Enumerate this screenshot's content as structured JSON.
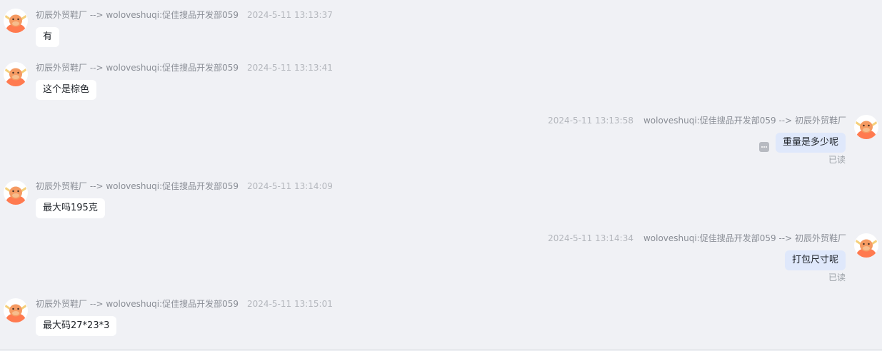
{
  "messages": [
    {
      "direction": "in",
      "sender": "初辰外贸鞋厂 --> woloveshuqi:促佳搜品开发部059",
      "time": "2024-5-11 13:13:37",
      "text": "有"
    },
    {
      "direction": "in",
      "sender": "初辰外贸鞋厂 --> woloveshuqi:促佳搜品开发部059",
      "time": "2024-5-11 13:13:41",
      "text": "这个是棕色"
    },
    {
      "direction": "out",
      "sender": "woloveshuqi:促佳搜品开发部059 --> 初辰外贸鞋厂",
      "time": "2024-5-11 13:13:58",
      "text": "重量是多少呢",
      "status": "已读"
    },
    {
      "direction": "in",
      "sender": "初辰外贸鞋厂 --> woloveshuqi:促佳搜品开发部059",
      "time": "2024-5-11 13:14:09",
      "text": "最大吗195克"
    },
    {
      "direction": "out",
      "sender": "woloveshuqi:促佳搜品开发部059 --> 初辰外贸鞋厂",
      "time": "2024-5-11 13:14:34",
      "text": "打包尺寸呢",
      "status": "已读"
    },
    {
      "direction": "in",
      "sender": "初辰外贸鞋厂 --> woloveshuqi:促佳搜品开发部059",
      "time": "2024-5-11 13:15:01",
      "text": "最大码27*23*3"
    }
  ],
  "icons": {
    "avatar": "cartoon-bull-avatar-icon",
    "more": "more-options-icon"
  },
  "colors": {
    "background": "#f0f1f5",
    "incoming_bubble": "#ffffff",
    "outgoing_bubble": "#dfe8fb",
    "meta_text": "#8a8e96",
    "avatar_body": "#ff7a4f",
    "avatar_horn": "#f5cf7a"
  }
}
